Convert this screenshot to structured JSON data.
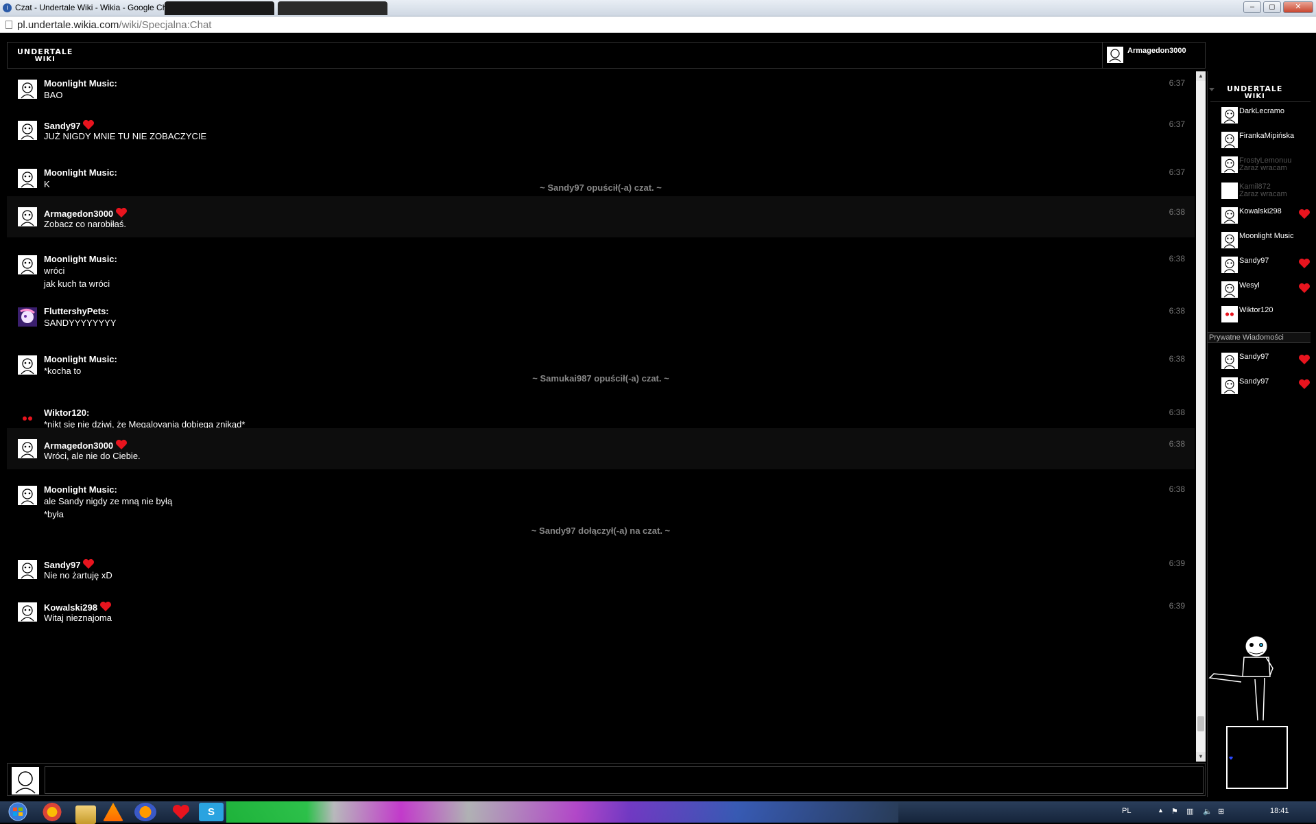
{
  "browser": {
    "window_title": "Czat - Undertale Wiki - Wikia - Google Chrome",
    "url_host": "pl.undertale.wikia.com",
    "url_path": "/wiki/Specjalna:Chat",
    "minimize": "–",
    "maximize": "◻",
    "close": "✕"
  },
  "header": {
    "logo_line1": "UNDERTALE",
    "logo_line2": "WIKI",
    "current_user": "Armagedon3000"
  },
  "messages": [
    {
      "user": "Moonlight Music:",
      "lines": [
        "BAO"
      ],
      "time": "6:37"
    },
    {
      "user": "Sandy97",
      "heart": true,
      "lines": [
        "JUŻ NIGDY MNIE TU NIE ZOBACZYCIE"
      ],
      "time": "6:37"
    },
    {
      "user": "Moonlight Music:",
      "lines": [
        "K"
      ],
      "time": "6:37"
    },
    {
      "event": "~ Sandy97 opuścił(-a) czat. ~"
    },
    {
      "user": "Armagedon3000",
      "heart": true,
      "self": true,
      "lines": [
        "Zobacz co narobiłaś."
      ],
      "time": "6:38"
    },
    {
      "user": "Moonlight Music:",
      "lines": [
        "wróci",
        "jak kuch ta wróci"
      ],
      "time": "6:38"
    },
    {
      "user": "FluttershyPets:",
      "lines": [
        "SANDYYYYYYYY"
      ],
      "time": "6:38"
    },
    {
      "user": "Moonlight Music:",
      "lines": [
        "*kocha to"
      ],
      "time": "6:38"
    },
    {
      "event": "~ Samukai987 opuścił(-a) czat. ~"
    },
    {
      "user": "Wiktor120:",
      "lines": [
        "*nikt się nie dziwi, że Megalovania dobiega znikąd*"
      ],
      "time": "6:38"
    },
    {
      "user": "Armagedon3000",
      "heart": true,
      "self": true,
      "lines": [
        "Wróci, ale nie do Ciebie."
      ],
      "time": "6:38"
    },
    {
      "user": "Moonlight Music:",
      "lines": [
        "ale Sandy nigdy ze mną nie byłą",
        "*była"
      ],
      "time": "6:38"
    },
    {
      "event": "~ Sandy97 dołączył(-a) na czat. ~"
    },
    {
      "user": "Sandy97",
      "heart": true,
      "lines": [
        "Nie no żartuję xD"
      ],
      "time": "6:39"
    },
    {
      "user": "Kowalski298",
      "heart": true,
      "lines": [
        "Witaj nieznajoma"
      ],
      "time": "6:39"
    }
  ],
  "input": {
    "value": ""
  },
  "rail": {
    "logo_line1": "UNDERTALE",
    "logo_line2": "WIKI",
    "users": [
      {
        "name": "DarkLecramo",
        "status": "",
        "away": false,
        "heart": false
      },
      {
        "name": "FirankaMipińska",
        "status": "",
        "away": false,
        "heart": false
      },
      {
        "name": "FrostyLemonuu",
        "status": "Zaraz wracam",
        "away": true,
        "heart": false
      },
      {
        "name": "Kamil872",
        "status": "Zaraz wracam",
        "away": true,
        "heart": false
      },
      {
        "name": "Kowalski298",
        "status": "",
        "away": false,
        "heart": true
      },
      {
        "name": "Moonlight Music",
        "status": "",
        "away": false,
        "heart": false
      },
      {
        "name": "Sandy97",
        "status": "",
        "away": false,
        "heart": true
      },
      {
        "name": "Wesyl",
        "status": "",
        "away": false,
        "heart": true
      },
      {
        "name": "Wiktor120",
        "status": "",
        "away": false,
        "heart": false
      }
    ],
    "pm_header": "Prywatne Wiadomości",
    "pm_users": [
      {
        "name": "Sandy97",
        "heart": true
      },
      {
        "name": "Sandy97",
        "heart": true
      }
    ]
  },
  "taskbar": {
    "language": "PL",
    "clock": "18:41"
  },
  "colors": {
    "heart": "#e8141e",
    "background": "#000000",
    "event_text": "#888888",
    "time_text": "#777777"
  }
}
